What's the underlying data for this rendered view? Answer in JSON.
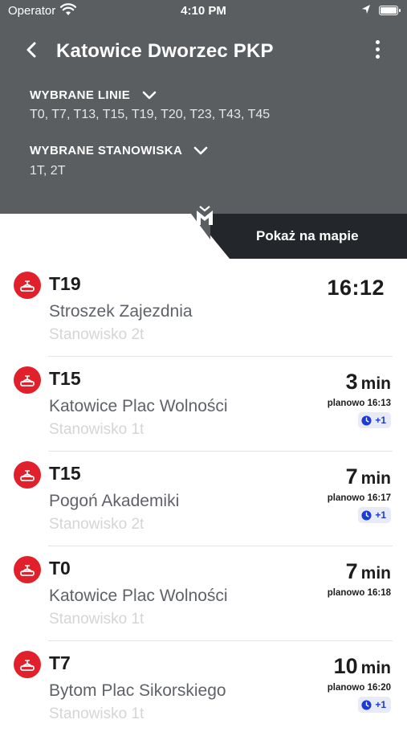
{
  "status_bar": {
    "carrier": "Operator",
    "time": "4:10 PM"
  },
  "header": {
    "title": "Katowice Dworzec PKP",
    "filters": [
      {
        "label": "WYBRANE LINIE",
        "value": "T0, T7, T13, T15, T19, T20, T23, T43, T45"
      },
      {
        "label": "WYBRANE STANOWISKA",
        "value": "1T, 2T"
      }
    ]
  },
  "map_button": {
    "label": "Pokaż na mapie"
  },
  "colors": {
    "header_bg": "#5b5e61",
    "tram_red": "#e2202b",
    "map_bar": "#23272b",
    "delay_blue": "#1a3bd8"
  },
  "departures": [
    {
      "line": "T19",
      "destination": "Stroszek Zajezdnia",
      "stop": "Stanowisko 2t",
      "time": "16:12"
    },
    {
      "line": "T15",
      "destination": "Katowice Plac Wolności",
      "stop": "Stanowisko 1t",
      "minutes": "3",
      "unit": "min",
      "planned": "planowo 16:13",
      "delay": "+1"
    },
    {
      "line": "T15",
      "destination": "Pogoń Akademiki",
      "stop": "Stanowisko 2t",
      "minutes": "7",
      "unit": "min",
      "planned": "planowo 16:17",
      "delay": "+1"
    },
    {
      "line": "T0",
      "destination": "Katowice Plac Wolności",
      "stop": "Stanowisko 1t",
      "minutes": "7",
      "unit": "min",
      "planned": "planowo 16:18"
    },
    {
      "line": "T7",
      "destination": "Bytom Plac Sikorskiego",
      "stop": "Stanowisko 1t",
      "minutes": "10",
      "unit": "min",
      "planned": "planowo 16:20",
      "delay": "+1"
    }
  ]
}
